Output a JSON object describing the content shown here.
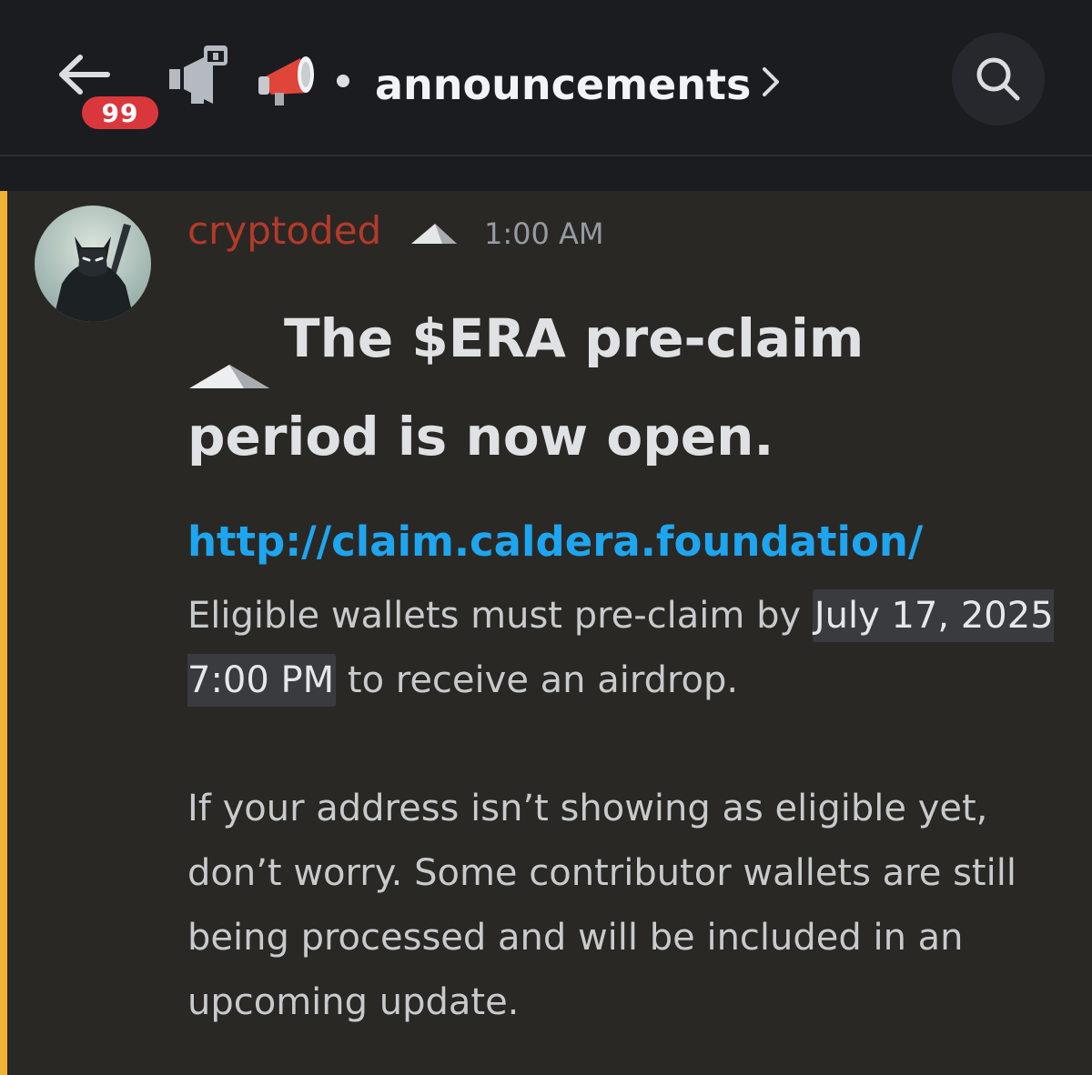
{
  "header": {
    "back_icon": "arrow-left-icon",
    "unread_badge": "99",
    "channel_type_icon": "announcement-channel-icon",
    "channel_emoji_icon": "megaphone-icon",
    "channel_name": "announcements",
    "chevron_icon": "chevron-right-icon",
    "search_icon": "search-icon"
  },
  "message": {
    "author": "cryptoded",
    "author_color": "#b33a2b",
    "role_icon": "mountain-icon",
    "timestamp": "1:00 AM",
    "heading": "The $ERA pre-claim period is now open.",
    "link": "http://claim.caldera.foundation/",
    "para1_prefix": "Eligible wallets must pre-claim by ",
    "para1_date": "July 17, 2025 7:00 PM",
    "para1_suffix": " to receive an airdrop.",
    "para2": "If your address isn’t showing as eligible yet, don’t worry. Some contributor wallets are still being processed and will be included in an upcoming update."
  },
  "colors": {
    "header_bg": "#1b1c20",
    "message_bg": "#2a2824",
    "mention_bar": "#f0b232",
    "badge_bg": "#da373c",
    "link": "#1ea5f0"
  }
}
